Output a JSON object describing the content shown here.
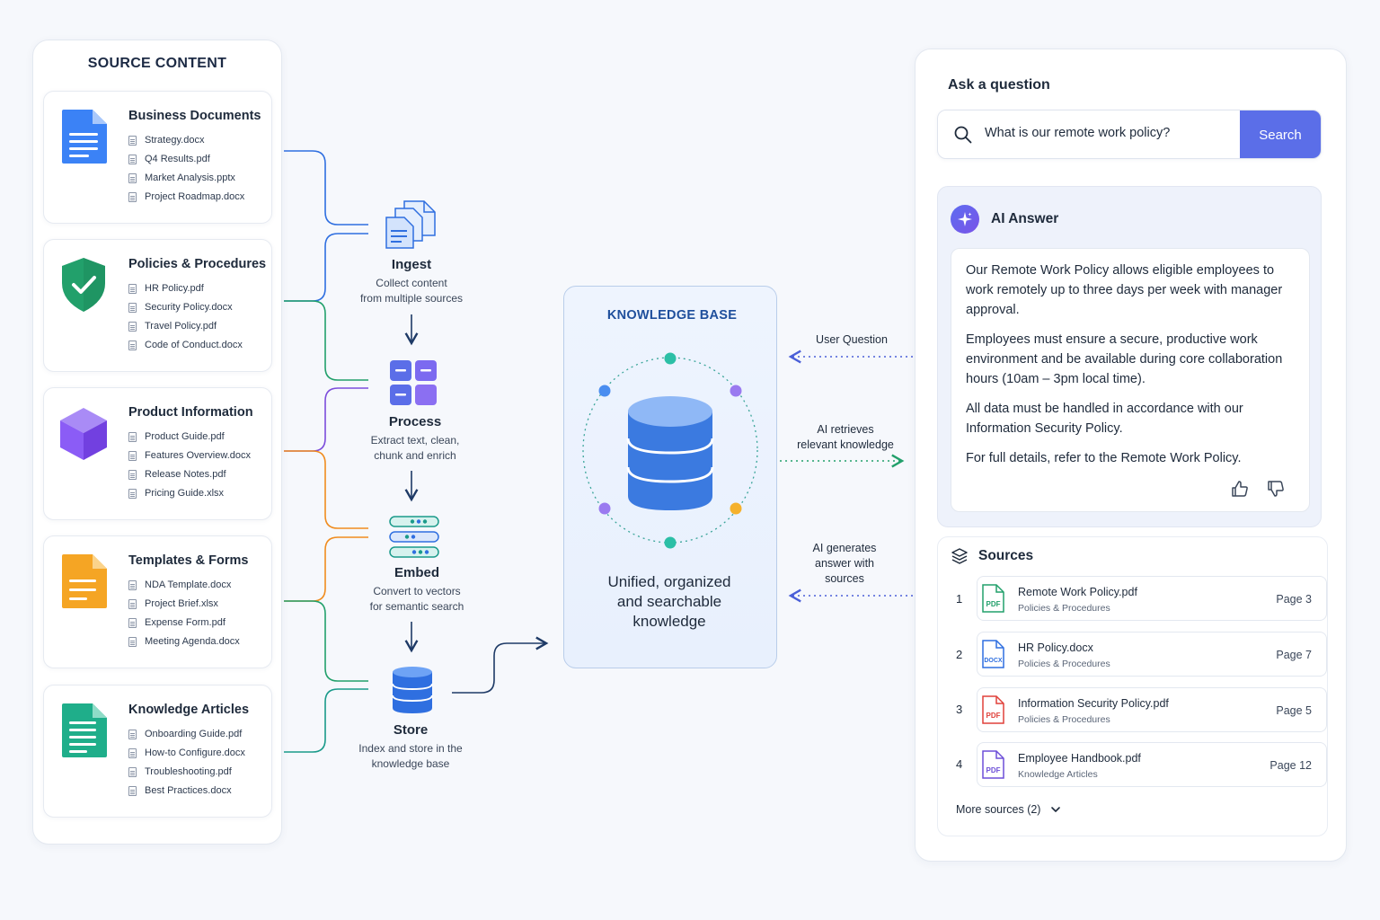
{
  "source_panel": {
    "title": "SOURCE CONTENT",
    "cards": [
      {
        "title": "Business Documents",
        "files": [
          "Strategy.docx",
          "Q4 Results.pdf",
          "Market Analysis.pptx",
          "Project Roadmap.docx"
        ],
        "icon": "document-icon",
        "color": "#3b82f6"
      },
      {
        "title": "Policies & Procedures",
        "files": [
          "HR Policy.pdf",
          "Security Policy.docx",
          "Travel Policy.pdf",
          "Code of Conduct.docx"
        ],
        "icon": "shield-icon",
        "color": "#22a06b"
      },
      {
        "title": "Product Information",
        "files": [
          "Product Guide.pdf",
          "Features Overview.docx",
          "Release Notes.pdf",
          "Pricing Guide.xlsx"
        ],
        "icon": "cube-icon",
        "color": "#8b5cf6"
      },
      {
        "title": "Templates & Forms",
        "files": [
          "NDA Template.docx",
          "Project Brief.xlsx",
          "Expense Form.pdf",
          "Meeting Agenda.docx"
        ],
        "icon": "form-icon",
        "color": "#f5a524"
      },
      {
        "title": "Knowledge Articles",
        "files": [
          "Onboarding Guide.pdf",
          "How-to Configure.docx",
          "Troubleshooting.pdf",
          "Best Practices.docx"
        ],
        "icon": "article-icon",
        "color": "#1fae8a"
      }
    ]
  },
  "pipeline": {
    "steps": [
      {
        "title": "Ingest",
        "desc_1": "Collect content",
        "desc_2": "from multiple sources",
        "icon": "documents-icon"
      },
      {
        "title": "Process",
        "desc_1": "Extract text, clean,",
        "desc_2": "chunk and enrich",
        "icon": "grid-icon"
      },
      {
        "title": "Embed",
        "desc_1": "Convert to vectors",
        "desc_2": "for semantic search",
        "icon": "vectors-icon"
      },
      {
        "title": "Store",
        "desc_1": "Index and store in the",
        "desc_2": "knowledge base",
        "icon": "database-icon"
      }
    ]
  },
  "knowledge_base": {
    "title": "KNOWLEDGE BASE",
    "caption_1": "Unified, organized",
    "caption_2": "and searchable",
    "caption_3": "knowledge",
    "icon": "database-icon"
  },
  "connectors": {
    "user_question": "User Question",
    "ai_retrieves_1": "AI retrieves",
    "ai_retrieves_2": "relevant knowledge",
    "ai_generates_1": "AI generates",
    "ai_generates_2": "answer with",
    "ai_generates_3": "sources"
  },
  "qa_panel": {
    "title": "Ask a question",
    "search_query": "What is our remote work policy?",
    "search_button": "Search",
    "ai_title": "AI Answer",
    "answer_paragraphs": [
      "Our Remote Work Policy allows eligible employees to work remotely up to three days per week with manager approval.",
      "Employees must ensure a secure, productive work environment and be available during core collaboration hours (10am – 3pm local time).",
      "All data must be handled in accordance with our Information Security Policy.",
      "For full details, refer to the Remote Work Policy."
    ],
    "sources_title": "Sources",
    "sources": [
      {
        "num": "1",
        "name": "Remote Work Policy.pdf",
        "category": "Policies & Procedures",
        "page": "Page 3",
        "type": "PDF",
        "color": "#22a06b"
      },
      {
        "num": "2",
        "name": "HR Policy.docx",
        "category": "Policies & Procedures",
        "page": "Page 7",
        "type": "DOCX",
        "color": "#2f6fe0"
      },
      {
        "num": "3",
        "name": "Information Security Policy.pdf",
        "category": "Policies & Procedures",
        "page": "Page 5",
        "type": "PDF",
        "color": "#e0413a"
      },
      {
        "num": "4",
        "name": "Employee Handbook.pdf",
        "category": "Knowledge Articles",
        "page": "Page 12",
        "type": "PDF",
        "color": "#6d4fd8"
      }
    ],
    "more_sources": "More sources (2)"
  },
  "colors": {
    "accent": "#5b6ee8",
    "kb_blue": "#3b7ae0",
    "line_blue": "#2f6fe0",
    "line_green": "#22a06b",
    "line_purple": "#7c4ddb",
    "line_orange": "#f08c1e",
    "line_teal": "#1a9a8a"
  }
}
